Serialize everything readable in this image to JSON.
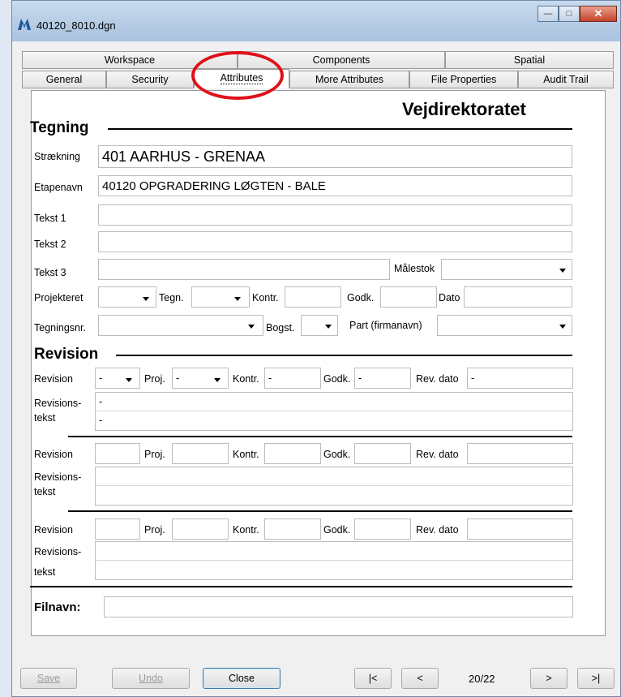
{
  "window": {
    "title": "40120_8010.dgn"
  },
  "tabs": {
    "row1": [
      "Workspace",
      "Components",
      "Spatial"
    ],
    "row2": [
      "General",
      "Security",
      "Attributes",
      "More Attributes",
      "File Properties",
      "Audit Trail"
    ],
    "active": "Attributes"
  },
  "brand": "Vejdirektoratet",
  "tegning": {
    "title": "Tegning",
    "straekning_label": "Strækning",
    "straekning_value": "401 AARHUS - GRENAA",
    "etapenavn_label": "Etapenavn",
    "etapenavn_value": "40120 OPGRADERING LØGTEN - BALE",
    "tekst1_label": "Tekst 1",
    "tekst2_label": "Tekst 2",
    "tekst3_label": "Tekst 3",
    "malestok_label": "Målestok",
    "projekteret_label": "Projekteret",
    "tegn_label": "Tegn.",
    "kontr_label": "Kontr.",
    "godk_label": "Godk.",
    "dato_label": "Dato",
    "tegningsnr_label": "Tegningsnr.",
    "bogst_label": "Bogst.",
    "part_label": "Part (firmanavn)"
  },
  "revision": {
    "title": "Revision",
    "revision_label": "Revision",
    "proj_label": "Proj.",
    "kontr_label": "Kontr.",
    "godk_label": "Godk.",
    "revdato_label": "Rev. dato",
    "tekst_label_1": "Revisions-",
    "tekst_label_2": "tekst",
    "rev1": {
      "revision": "-",
      "proj": "-",
      "kontr": "-",
      "godk": "-",
      "revdato": "-",
      "tekst_line1": "-",
      "tekst_line2": "-"
    }
  },
  "filnavn_label": "Filnavn:",
  "footer": {
    "save": "Save",
    "undo": "Undo",
    "close": "Close",
    "first": "|<",
    "prev": "<",
    "page": "20/22",
    "next": ">",
    "last": ">|"
  }
}
